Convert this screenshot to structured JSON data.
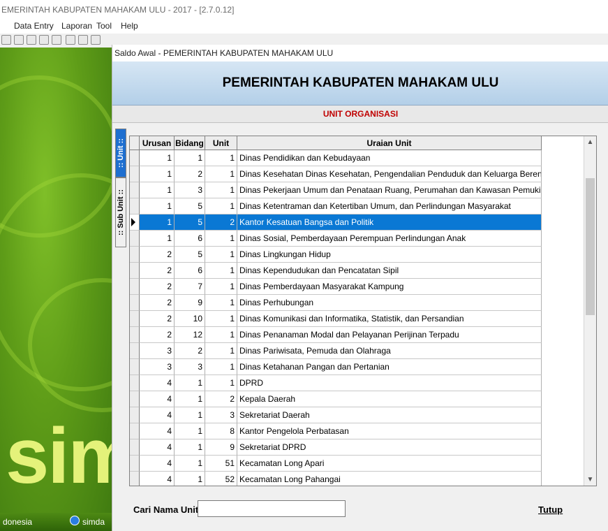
{
  "app": {
    "title": "EMERINTAH KABUPATEN MAHAKAM ULU - 2017 - [2.7.0.12]",
    "menu": [
      "Data Entry",
      "Laporan",
      "Tool",
      "Help"
    ],
    "brand_text": "sime",
    "status_left": "donesia",
    "status_right": "simda"
  },
  "dialog": {
    "title": "Saldo Awal - PEMERINTAH KABUPATEN MAHAKAM ULU",
    "header": "PEMERINTAH KABUPATEN MAHAKAM ULU",
    "subheader": "UNIT ORGANISASI",
    "tabs": [
      ":: Unit ::",
      ":: Sub Unit ::"
    ],
    "columns": [
      "Urusan",
      "Bidang",
      "Unit",
      "Uraian Unit"
    ],
    "selected_row": 4,
    "rows": [
      [
        "1",
        "1",
        "1",
        "Dinas Pendidikan dan Kebudayaan"
      ],
      [
        "1",
        "2",
        "1",
        "Dinas Kesehatan Dinas Kesehatan, Pengendalian Penduduk dan Keluarga Berenca"
      ],
      [
        "1",
        "3",
        "1",
        "Dinas Pekerjaan Umum dan Penataan Ruang, Perumahan dan Kawasan Pemukima"
      ],
      [
        "1",
        "5",
        "1",
        "Dinas Ketentraman dan Ketertiban Umum, dan Perlindungan Masyarakat"
      ],
      [
        "1",
        "5",
        "2",
        "Kantor Kesatuan Bangsa dan Politik"
      ],
      [
        "1",
        "6",
        "1",
        "Dinas Sosial, Pemberdayaan Perempuan Perlindungan Anak"
      ],
      [
        "2",
        "5",
        "1",
        "Dinas Lingkungan Hidup"
      ],
      [
        "2",
        "6",
        "1",
        "Dinas Kependudukan dan Pencatatan Sipil"
      ],
      [
        "2",
        "7",
        "1",
        "Dinas Pemberdayaan Masyarakat Kampung"
      ],
      [
        "2",
        "9",
        "1",
        "Dinas Perhubungan"
      ],
      [
        "2",
        "10",
        "1",
        "Dinas Komunikasi dan Informatika, Statistik, dan Persandian"
      ],
      [
        "2",
        "12",
        "1",
        "Dinas Penanaman Modal dan Pelayanan Perijinan Terpadu"
      ],
      [
        "3",
        "2",
        "1",
        "Dinas Pariwisata, Pemuda dan Olahraga"
      ],
      [
        "3",
        "3",
        "1",
        "Dinas Ketahanan Pangan dan Pertanian"
      ],
      [
        "4",
        "1",
        "1",
        "DPRD"
      ],
      [
        "4",
        "1",
        "2",
        "Kepala Daerah"
      ],
      [
        "4",
        "1",
        "3",
        "Sekretariat Daerah"
      ],
      [
        "4",
        "1",
        "8",
        "Kantor Pengelola Perbatasan"
      ],
      [
        "4",
        "1",
        "9",
        "Sekretariat DPRD"
      ],
      [
        "4",
        "1",
        "51",
        "Kecamatan Long Apari"
      ],
      [
        "4",
        "1",
        "52",
        "Kecamatan Long Pahangai"
      ]
    ],
    "search_label": "Cari Nama Unit",
    "search_value": "",
    "close_label": "Tutup"
  },
  "colors": {
    "selection": "#0a78d4",
    "subheader_text": "#c00000",
    "header_band": "#c4daee"
  }
}
